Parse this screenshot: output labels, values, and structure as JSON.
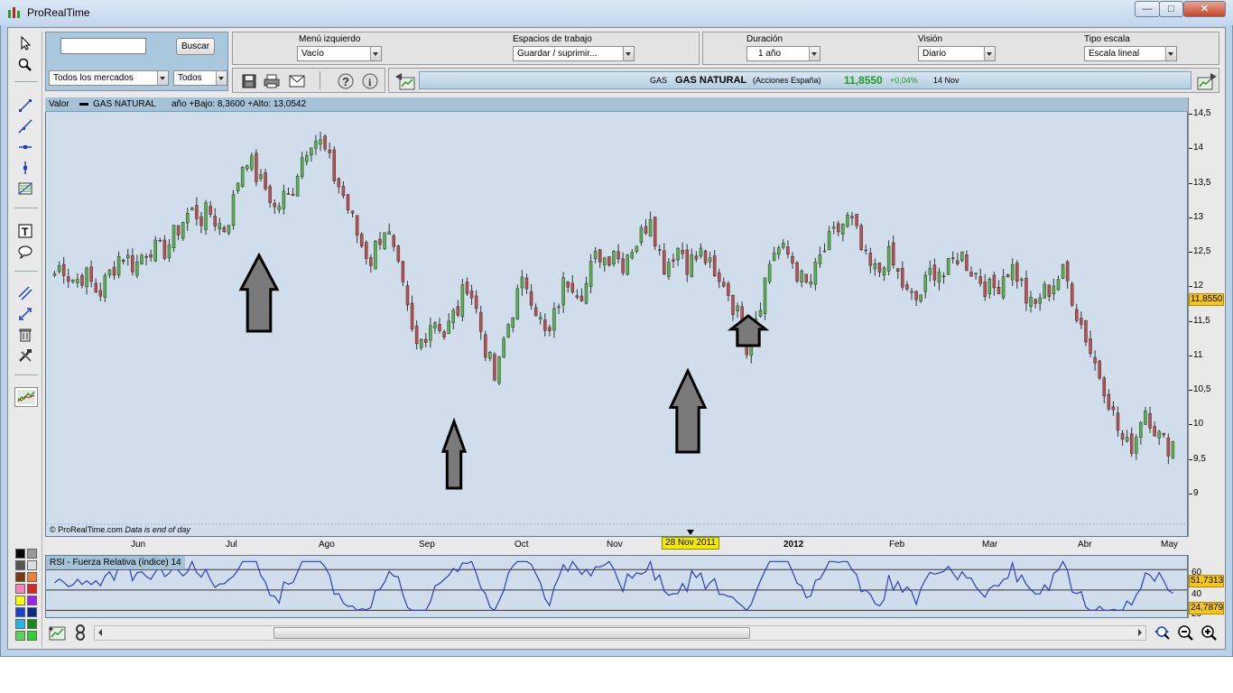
{
  "window": {
    "title": "ProRealTime",
    "min_label": "—",
    "max_label": "□",
    "close_label": "✕"
  },
  "search": {
    "button": "Buscar",
    "markets": "Todos los mercados",
    "filter": "Todos"
  },
  "workspace": {
    "left_menu_label": "Menú izquierdo",
    "left_menu_value": "Vacío",
    "workspaces_label": "Espacios de trabajo",
    "workspaces_value": "Guardar / suprimir...",
    "duration_label": "Duración",
    "duration_value": "1 año",
    "view_label": "Visión",
    "view_value": "Diario",
    "scale_label": "Tipo escala",
    "scale_value": "Escala lineal"
  },
  "ticker": {
    "symbol": "GAS",
    "name": "GAS NATURAL",
    "market": "(Acciones España)",
    "price": "11,8550",
    "change": "+0,04%",
    "date": "14 Nov"
  },
  "chart_header": {
    "valor": "Valor",
    "series": "GAS NATURAL",
    "stats": "año +Bajo: 8,3600 +Alto: 13,0542"
  },
  "watermark": {
    "brand": "© ProRealTime.com",
    "note": "Data is end of day"
  },
  "current_price_label": "11,8550",
  "cursor_date_label": "28 Nov 2011",
  "rsi": {
    "title": "RSI - Fuerza Relativa (índice) 14",
    "value": "51,7313",
    "low": "24,7879",
    "ticks": [
      "60",
      "40",
      "20"
    ]
  },
  "colors": {
    "up": "#56b64b",
    "down": "#c24d4d",
    "rsi_line": "#2c3ec4",
    "chart_bg": "#cfdeea",
    "header_bg": "#a6c2d7",
    "price_tag": "#f5c518"
  },
  "chart_data": {
    "type": "candlestick",
    "title": "",
    "xlabel": "",
    "ylabel": "",
    "ylim": [
      8.5,
      14.5
    ],
    "y_ticks": [
      "14,5",
      "14",
      "13,5",
      "13",
      "12,5",
      "12",
      "11,5",
      "11",
      "10,5",
      "10",
      "9,5",
      "9"
    ],
    "x_ticks": [
      "Jun",
      "Jul",
      "Ago",
      "Sep",
      "Oct",
      "Nov",
      "2012",
      "Feb",
      "Mar",
      "Abr",
      "May"
    ],
    "close_path": [
      12.2,
      12.35,
      12.15,
      12.1,
      12.2,
      12.05,
      11.9,
      12.1,
      12.3,
      12.5,
      12.4,
      12.3,
      12.5,
      12.6,
      12.5,
      12.55,
      12.7,
      12.9,
      13.05,
      13.1,
      13.0,
      13.1,
      12.95,
      12.85,
      13.1,
      13.6,
      13.95,
      13.7,
      13.5,
      13.4,
      13.1,
      13.3,
      13.3,
      13.7,
      14.0,
      14.2,
      14.1,
      13.9,
      13.6,
      13.4,
      13.1,
      12.8,
      12.55,
      12.4,
      12.7,
      12.9,
      12.5,
      12.1,
      11.6,
      11.1,
      11.25,
      11.5,
      11.55,
      11.3,
      11.55,
      11.7,
      12.1,
      11.8,
      11.35,
      10.95,
      10.6,
      11.2,
      11.6,
      11.9,
      12.1,
      11.85,
      11.5,
      11.2,
      11.6,
      12.0,
      12.15,
      12.0,
      11.95,
      12.3,
      12.5,
      12.4,
      12.6,
      12.3,
      12.55,
      12.65,
      12.8,
      13.1,
      12.55,
      12.3,
      12.5,
      12.6,
      12.35,
      12.4,
      12.5,
      12.3,
      12.0,
      12.1,
      11.8,
      11.55,
      11.15,
      11.5,
      11.85,
      12.3,
      12.6,
      12.5,
      12.45,
      12.2,
      12.0,
      12.1,
      12.4,
      12.6,
      12.75,
      12.9,
      13.0,
      12.75,
      12.4,
      12.25,
      12.2,
      12.5,
      12.3,
      12.1,
      11.85,
      11.8,
      11.95,
      12.2,
      12.3,
      12.15,
      12.35,
      12.5,
      12.35,
      12.2,
      12.1,
      11.95,
      12.0,
      12.2,
      12.3,
      12.15,
      11.85,
      11.65,
      11.9,
      11.95,
      12.1,
      12.2,
      12.0,
      11.6,
      11.35,
      11.0,
      10.75,
      10.5,
      10.1,
      9.8,
      9.65,
      9.85,
      10.3,
      10.1,
      9.85,
      9.7,
      9.75
    ],
    "annotations": [
      "up-arrow Jul",
      "up-arrow Sep",
      "up-arrow Nov",
      "up-arrow Dec"
    ]
  }
}
